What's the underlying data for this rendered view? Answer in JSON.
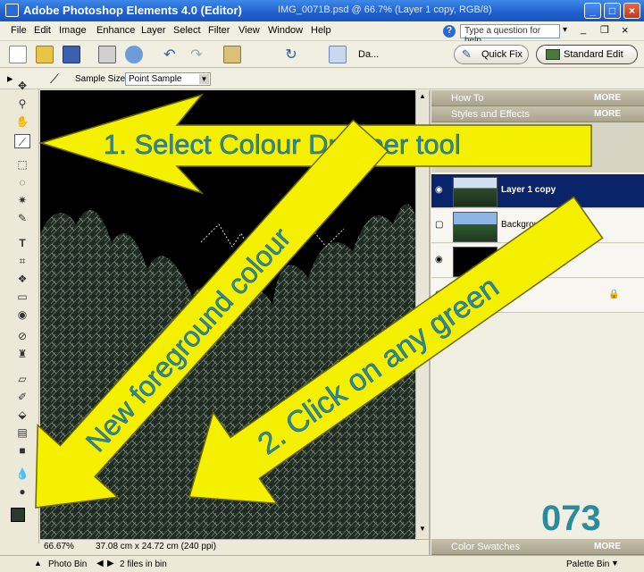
{
  "window": {
    "app_title": "Adobe Photoshop Elements 4.0 (Editor)",
    "doc_title": "IMG_0071B.psd @ 66.7% (Layer 1 copy, RGB/8)"
  },
  "menubar": {
    "items": [
      "File",
      "Edit",
      "Image",
      "Enhance",
      "Layer",
      "Select",
      "Filter",
      "View",
      "Window",
      "Help"
    ],
    "help_placeholder": "Type a question for help"
  },
  "toolbar": {
    "partial_label": "Da...",
    "quick_fix": "Quick Fix",
    "standard_edit": "Standard Edit"
  },
  "options": {
    "sample_size_label": "Sample Size:",
    "sample_size_value": "Point Sample"
  },
  "palette": {
    "panels": [
      {
        "title": "How To",
        "more": "MORE"
      },
      {
        "title": "Styles and Effects",
        "more": "MORE"
      }
    ],
    "layers": [
      {
        "name": "Layer 1 copy",
        "selected": true
      },
      {
        "name": "Background copy",
        "selected": false
      },
      {
        "name": "",
        "selected": false
      },
      {
        "name": "",
        "selected": false
      }
    ],
    "swatches": {
      "title": "Color Swatches",
      "more": "MORE"
    }
  },
  "status": {
    "zoom": "66.67%",
    "doc_size": "37.08 cm x 24.72 cm (240 ppi)"
  },
  "bottombar": {
    "photo_bin": "Photo Bin",
    "files_in_bin": "2 files in bin",
    "palette_bin": "Palette Bin"
  },
  "annotations": {
    "step1": "1. Select Colour Dropper tool",
    "new_fg": "New foreground colour",
    "step2": "2. Click on any green"
  },
  "watermark": "073",
  "colors": {
    "arrow_fill": "#f5f000",
    "arrow_text": "#2b8a9c",
    "layer_selected": "#0a246a"
  }
}
